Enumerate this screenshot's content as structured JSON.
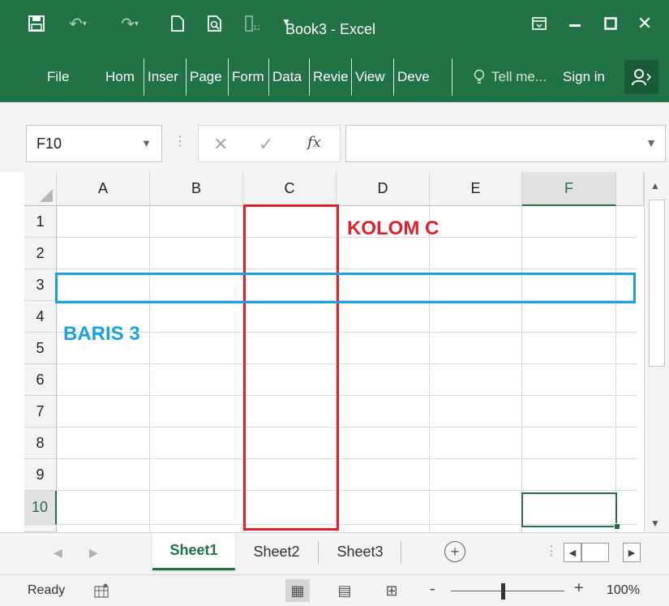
{
  "titlebar": {
    "title": "Book3 - Excel",
    "caret": "▼",
    "save_icon": "save-icon",
    "undo_icon": "undo-icon",
    "redo_icon": "redo-icon",
    "accent_color": "#217346"
  },
  "ribbon": {
    "tabs": [
      "File",
      "Hom",
      "Inser",
      "Page",
      "Form",
      "Data",
      "Revie",
      "View",
      "Deve"
    ],
    "tell_me": "Tell me...",
    "sign_in": "Sign in"
  },
  "formula_bar": {
    "name_box": "F10",
    "formula": "",
    "fx_label": "fx"
  },
  "grid": {
    "columns": [
      "A",
      "B",
      "C",
      "D",
      "E",
      "F"
    ],
    "rows": [
      "1",
      "2",
      "3",
      "4",
      "5",
      "6",
      "7",
      "8",
      "9",
      "10"
    ],
    "active_column": "F",
    "active_row": "10"
  },
  "annotations": {
    "column_label": "KOLOM C",
    "row_label": "BARIS 3",
    "column_color": "#e0202a",
    "row_color": "#1ba1e2"
  },
  "sheets": {
    "tabs": [
      "Sheet1",
      "Sheet2",
      "Sheet3"
    ],
    "active": "Sheet1",
    "add_label": "+"
  },
  "statusbar": {
    "status": "Ready",
    "zoom": "100%",
    "zoom_minus": "-",
    "zoom_plus": "+",
    "zoom_fraction": 0.46
  }
}
